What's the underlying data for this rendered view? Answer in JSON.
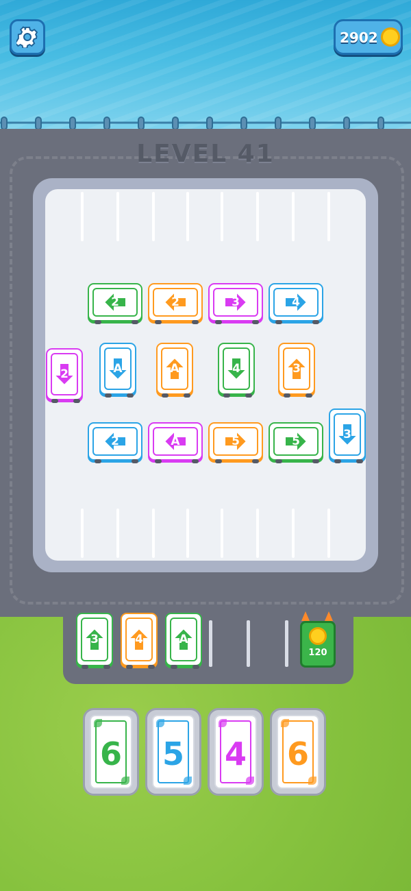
{
  "header": {
    "settings_icon": "gear-icon",
    "coins": "2902",
    "coin_icon": "coin-icon",
    "level_title": "LEVEL 41"
  },
  "colors": {
    "green": "#37b44a",
    "orange": "#ff9a1f",
    "magenta": "#d93bf2",
    "blue": "#2ba4e6"
  },
  "parked_cars": [
    {
      "label": "2",
      "color": "green",
      "direction": "left"
    },
    {
      "label": "2",
      "color": "orange",
      "direction": "left"
    },
    {
      "label": "3",
      "color": "magenta",
      "direction": "right"
    },
    {
      "label": "4",
      "color": "blue",
      "direction": "right"
    },
    {
      "label": "2",
      "color": "magenta",
      "direction": "down"
    },
    {
      "label": "A",
      "color": "blue",
      "direction": "down"
    },
    {
      "label": "A",
      "color": "orange",
      "direction": "up"
    },
    {
      "label": "4",
      "color": "green",
      "direction": "down"
    },
    {
      "label": "3",
      "color": "orange",
      "direction": "up"
    },
    {
      "label": "2",
      "color": "blue",
      "direction": "left"
    },
    {
      "label": "A",
      "color": "magenta",
      "direction": "left"
    },
    {
      "label": "5",
      "color": "orange",
      "direction": "right"
    },
    {
      "label": "5",
      "color": "green",
      "direction": "right"
    },
    {
      "label": "3",
      "color": "blue",
      "direction": "down"
    }
  ],
  "queue_cars": [
    {
      "label": "3",
      "color": "green",
      "direction": "up"
    },
    {
      "label": "4",
      "color": "orange",
      "direction": "up"
    },
    {
      "label": "A",
      "color": "green",
      "direction": "up"
    }
  ],
  "bonus_slot": {
    "cost": "120",
    "icon": "coin-icon"
  },
  "cards": [
    {
      "value": "6",
      "color": "green"
    },
    {
      "value": "5",
      "color": "blue"
    },
    {
      "value": "4",
      "color": "magenta"
    },
    {
      "value": "6",
      "color": "orange"
    }
  ]
}
